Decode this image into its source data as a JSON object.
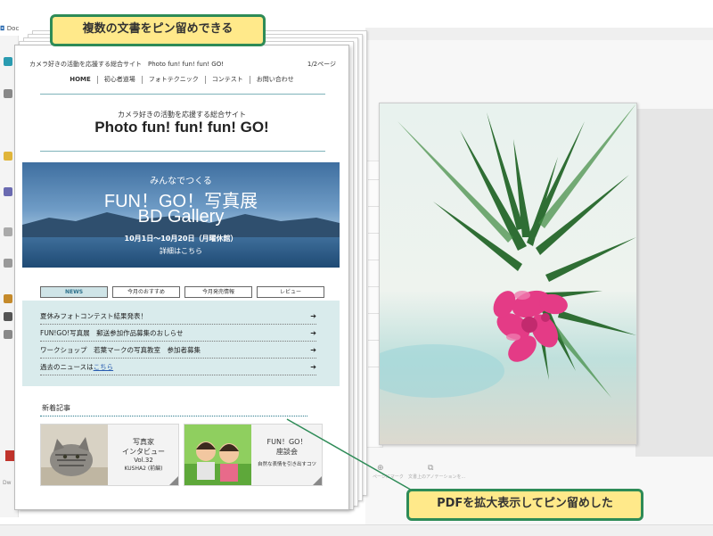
{
  "callouts": {
    "top": "複数の文書をピン留めできる",
    "bottom": "PDFを拡大表示してピン留めした"
  },
  "background_app": {
    "title": "Doc",
    "bottom_tools": {
      "add_mark": "ページにマーク",
      "annotation": "文書上のアノテーションを..."
    },
    "left_label": "Dw"
  },
  "pinned_pdf": {
    "header_left": "カメラ好きの活動を応援する総合サイト　Photo fun! fun! fun! GO!",
    "header_right": "1/2ページ",
    "nav": [
      "HOME",
      "初心者道場",
      "フォトテクニック",
      "コンテスト",
      "お問い合わせ"
    ],
    "subtitle": "カメラ好きの活動を応援する総合サイト",
    "site_title": "Photo fun! fun! fun! GO!",
    "banner": {
      "line1": "みんなでつくる",
      "line2": "FUN！GO！写真展",
      "line3": "BD Gallery",
      "date": "10月1日～10月20日（月曜休館）",
      "details": "詳細はこちら"
    },
    "tabs": [
      {
        "label": "NEWS",
        "active": true
      },
      {
        "label": "今月のおすすめ",
        "active": false
      },
      {
        "label": "今月発売情報",
        "active": false
      },
      {
        "label": "レビュー",
        "active": false
      }
    ],
    "news": [
      {
        "text": "夏休みフォトコンテスト結果発表！",
        "arrow": "➔"
      },
      {
        "text": "FUN!GO!写真展　郵送参加作品募集のおしらせ",
        "arrow": "➔"
      },
      {
        "text": "ワークショップ　若葉マークの写真教室　参加者募集",
        "arrow": "➔"
      },
      {
        "text": "過去のニュースは",
        "link": "こちら",
        "arrow": "➔"
      }
    ],
    "new_articles_heading": "新着記事",
    "cards": [
      {
        "line1": "写真家",
        "line2": "インタビュー",
        "line3": "Vol.32",
        "line4": "KUSHA2 (前編)"
      },
      {
        "line1": "FUN！GO！",
        "line2": "座談会",
        "line3": "自然な表情を引き出すコツ"
      }
    ]
  },
  "colors": {
    "callout_bg": "#ffe98a",
    "callout_border": "#2e8b57",
    "news_bg": "#d9ebec",
    "accent_line": "#7fb3ba"
  }
}
